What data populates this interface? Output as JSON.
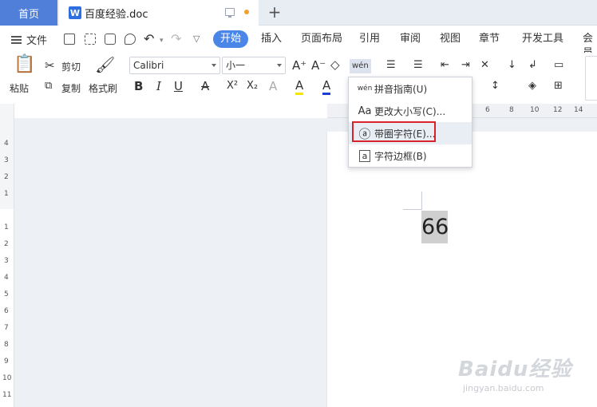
{
  "tabs": {
    "home": "首页",
    "doc": "百度经验.doc"
  },
  "menu": {
    "file": "文件",
    "start": "开始",
    "items": [
      "插入",
      "页面布局",
      "引用",
      "审阅",
      "视图",
      "章节",
      "开发工具",
      "会员"
    ]
  },
  "toolbar": {
    "paste": "粘贴",
    "cut": "剪切",
    "copy": "复制",
    "format_painter": "格式刷",
    "font_name": "Calibri",
    "font_size": "小一",
    "grow_font": "A⁺",
    "shrink_font": "A⁻",
    "phonetic_icon": "wén",
    "bold": "B",
    "italic": "I",
    "underline": "U",
    "strike": "A",
    "superscript": "X²",
    "subscript": "X₂",
    "effects": "A",
    "highlight": "A",
    "font_color": "A"
  },
  "ruler": {
    "h": [
      "6",
      "8",
      "10",
      "12",
      "14"
    ],
    "v": [
      "4",
      "3",
      "2",
      "1",
      "1",
      "2",
      "3",
      "4",
      "5",
      "6",
      "7",
      "8",
      "9",
      "10",
      "11"
    ]
  },
  "dropdown": {
    "items": [
      {
        "icon": "wén",
        "label": "拼音指南(U)"
      },
      {
        "icon": "Aa",
        "label": "更改大小写(C)..."
      },
      {
        "icon": "ⓐ",
        "label": "带圈字符(E)..."
      },
      {
        "icon": "a",
        "label": "字符边框(B)"
      }
    ]
  },
  "document": {
    "text": "66"
  },
  "watermark": {
    "brand": "Baidu经验",
    "url": "jingyan.baidu.com"
  },
  "colors": {
    "accent": "#4a86e8",
    "highlight_border": "#d9232b"
  }
}
